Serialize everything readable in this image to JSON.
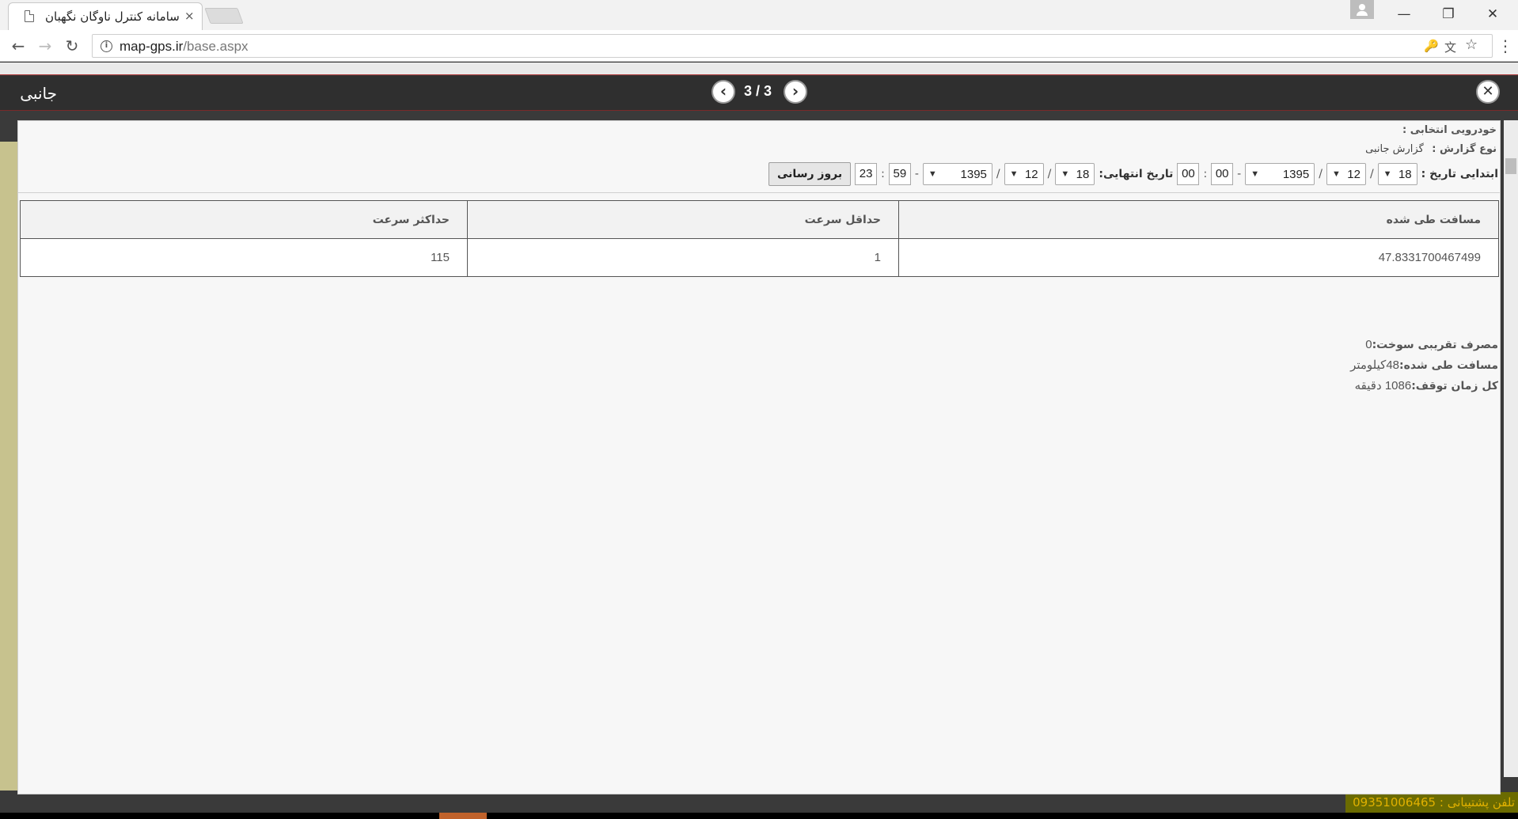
{
  "browser": {
    "tab_title": "سامانه کنترل ناوگان نگهبان",
    "tab_close": "×",
    "url_host": "map-gps.ir",
    "url_path": "/base.aspx",
    "win_minimize": "—",
    "win_restore": "❐",
    "win_close": "✕",
    "nav_back": "←",
    "nav_forward": "→",
    "nav_reload": "↻",
    "info_glyph": "i",
    "key_icon_glyph": "🔑",
    "translate_icon_glyph": "文",
    "star_icon_glyph": "☆",
    "menu_glyph": "⋮"
  },
  "background": {
    "footer_text": "تلفن پشتیبانی : 09351006465"
  },
  "modal": {
    "title": "جانبی",
    "pager": "3 / 3",
    "prev_glyph": "‹",
    "next_glyph": "›",
    "close_glyph": "✕"
  },
  "report": {
    "vehicle_label": "خودرویی انتخابی :",
    "type_label": "نوع گزارش :",
    "type_value": "گزارش جانبی",
    "start_label": "ابتدایی تاریخ :",
    "start": {
      "day": "18",
      "month": "12",
      "year": "1395",
      "hour": "00",
      "minute": "00"
    },
    "end_label": "تاریخ انتهایی:",
    "end": {
      "day": "18",
      "month": "12",
      "year": "1395",
      "minute": "59",
      "hour": "23"
    },
    "date_sep": "/",
    "time_sep": ":",
    "dash": "-",
    "dropdown_arrow": "▼",
    "update_button": "بروز رسانی"
  },
  "table": {
    "headers": [
      "مسافت طی شده",
      "حداقل سرعت",
      "حداکثر سرعت"
    ],
    "rows": [
      [
        "47.8331700467499",
        "1",
        "115"
      ]
    ]
  },
  "summary": {
    "fuel_label": "مصرف تقریبی سوخت:",
    "fuel_value": "0",
    "distance_label": "مسافت طی شده:",
    "distance_value": "48کیلومتر",
    "stop_label": "کل زمان توقف:",
    "stop_value": "1086 دقیقه"
  }
}
